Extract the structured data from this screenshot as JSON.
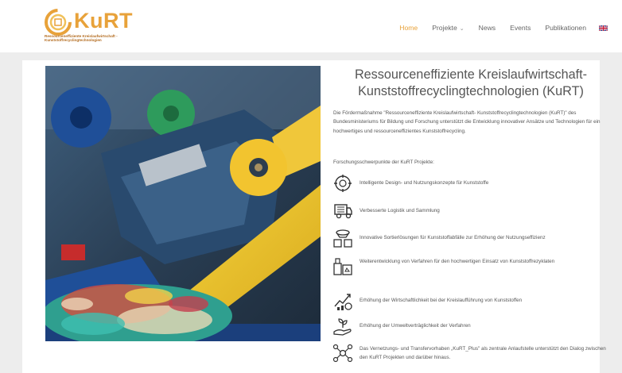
{
  "header": {
    "logo_text": "KuRT",
    "logo_sub": "Ressourceneffiziente Kreislaufwirtschaft - Kunststoffrecyclingtechnologien",
    "nav": [
      {
        "label": "Home",
        "active": true
      },
      {
        "label": "Projekte",
        "active": false,
        "has_dropdown": true
      },
      {
        "label": "News",
        "active": false
      },
      {
        "label": "Events",
        "active": false
      },
      {
        "label": "Publikationen",
        "active": false
      }
    ],
    "language_icon": "uk-flag-icon",
    "accent_color": "#e8a23a"
  },
  "main": {
    "title": "Ressourceneffiziente Kreislaufwirtschaft-Kunststoffrecyclingtechnologien (KuRT)",
    "intro": "Die Fördermaßnahme \"Ressourceneffiziente Kreislaufwirtschaft- Kunststoffrecyclingtechnologien (KuRT)\" des Bundesministeriums für Bildung und Forschung unterstützt die Entwicklung innovativer Ansätze und Technologien für ein hochwertiges und ressourceneffizientes Kunststoffrecycling.",
    "subhead": "Forschungsschwerpunkte der KuRT Projekte:",
    "features": [
      {
        "icon": "design-concept-icon",
        "text": "Intelligente Design- und Nutzungskonzepte für Kunststoffe"
      },
      {
        "icon": "logistics-truck-icon",
        "text": "Verbesserte Logistik und Sammlung"
      },
      {
        "icon": "sorting-bins-icon",
        "text": "Innovative Sortierlösungen für Kunststoffabfälle zur Erhöhung der Nutzungseffizienz"
      },
      {
        "icon": "recycling-process-icon",
        "text": "Weiterentwicklung von Verfahren für den hochwertigen Einsatz von Kunststoffrezyklaten"
      },
      {
        "icon": "economic-growth-icon",
        "text": "Erhöhung der Wirtschaftlichkeit bei der Kreislaufführung von Kunststoffen"
      },
      {
        "icon": "environment-hand-icon",
        "text": "Erhöhung der Umweltverträglichkeit der Verfahren"
      },
      {
        "icon": "network-icon",
        "text": "Das Vernetzungs- und Transfervorhaben „KuRT_Plus\" als zentrale Anlaufstelle unterstützt den Dialog zwischen den KuRT Projekten und darüber hinaus."
      }
    ]
  }
}
